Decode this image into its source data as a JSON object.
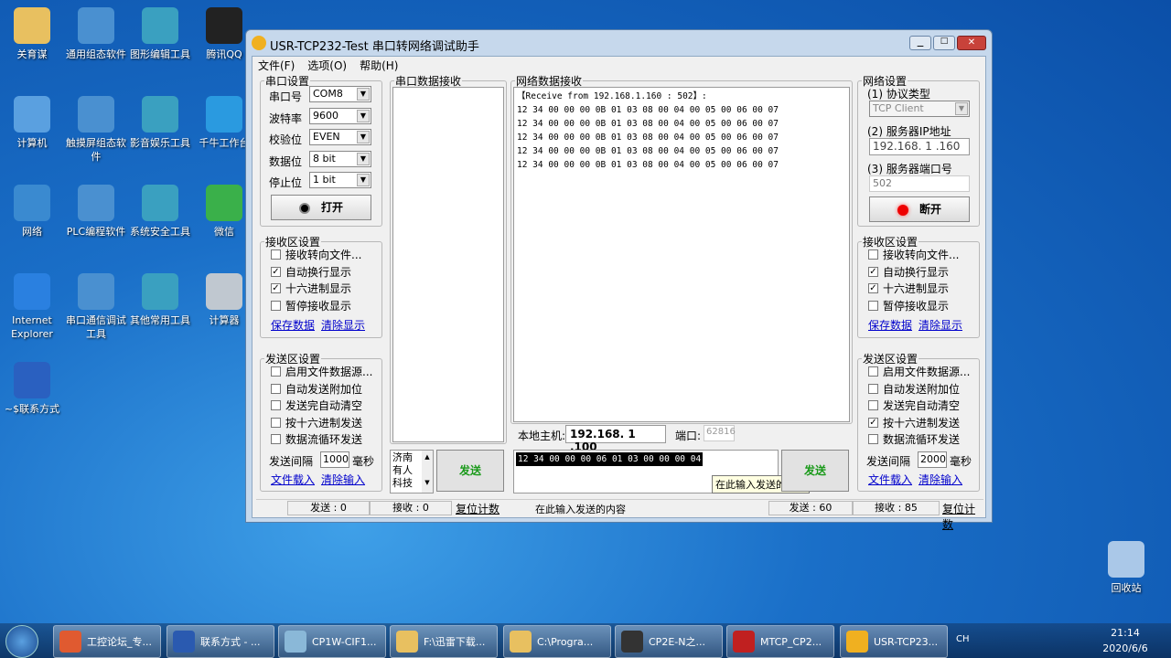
{
  "desktop": {
    "icons": [
      "关育谋",
      "通用组态软件",
      "图形编辑工具",
      "腾讯QQ",
      "计算机",
      "触摸屏组态软件",
      "影音娱乐工具",
      "千牛工作台",
      "网络",
      "PLC编程软件",
      "系统安全工具",
      "微信",
      "Internet Explorer",
      "串口通信调试工具",
      "其他常用工具",
      "计算器",
      "~$联系方式",
      "回收站"
    ]
  },
  "window": {
    "title": "USR-TCP232-Test 串口转网络调试助手",
    "menu": [
      "文件(F)",
      "选项(O)",
      "帮助(H)"
    ],
    "serial": {
      "legend": "串口设置",
      "fields": [
        {
          "label": "串口号",
          "value": "COM8"
        },
        {
          "label": "波特率",
          "value": "9600"
        },
        {
          "label": "校验位",
          "value": "EVEN"
        },
        {
          "label": "数据位",
          "value": "8 bit"
        },
        {
          "label": "停止位",
          "value": "1 bit"
        }
      ],
      "open_button": "打开"
    },
    "recv_left": {
      "legend": "接收区设置",
      "options": [
        {
          "label": "接收转向文件...",
          "checked": false
        },
        {
          "label": "自动换行显示",
          "checked": true
        },
        {
          "label": "十六进制显示",
          "checked": true
        },
        {
          "label": "暂停接收显示",
          "checked": false
        }
      ],
      "save": "保存数据",
      "clear": "清除显示"
    },
    "send_left": {
      "legend": "发送区设置",
      "options": [
        {
          "label": "启用文件数据源...",
          "checked": false
        },
        {
          "label": "自动发送附加位",
          "checked": false
        },
        {
          "label": "发送完自动清空",
          "checked": false
        },
        {
          "label": "按十六进制发送",
          "checked": false
        },
        {
          "label": "数据流循环发送",
          "checked": false
        }
      ],
      "interval_label": "发送间隔",
      "interval": "1000",
      "unit": "毫秒",
      "load": "文件载入",
      "clear": "清除输入"
    },
    "serial_recv": {
      "legend": "串口数据接收"
    },
    "serial_send": {
      "text": "济南\n有人\n科技",
      "button": "发送"
    },
    "net_recv": {
      "legend": "网络数据接收",
      "lines": [
        "【Receive from 192.168.1.160 : 502】:",
        "12 34 00 00 00 0B 01 03 08 00 04 00 05 00 06 00 07",
        "12 34 00 00 00 0B 01 03 08 00 04 00 05 00 06 00 07",
        "12 34 00 00 00 0B 01 03 08 00 04 00 05 00 06 00 07",
        "12 34 00 00 00 0B 01 03 08 00 04 00 05 00 06 00 07",
        "12 34 00 00 00 0B 01 03 08 00 04 00 05 00 06 00 07"
      ]
    },
    "local": {
      "host_label": "本地主机:",
      "host": "192.168. 1 .100",
      "port_label": "端口:",
      "port": "62816"
    },
    "net_send": {
      "text": "12 34 00 00 00 06 01 03 00 00 00 04",
      "button": "发送",
      "tooltip": "在此输入发送的内容"
    },
    "net": {
      "legend": "网络设置",
      "proto_label": "(1) 协议类型",
      "proto": "TCP Client",
      "ip_label": "(2) 服务器IP地址",
      "ip": "192.168. 1 .160",
      "port_label": "(3) 服务器端口号",
      "port": "502",
      "button": "断开"
    },
    "recv_right": {
      "legend": "接收区设置",
      "options": [
        {
          "label": "接收转向文件...",
          "checked": false
        },
        {
          "label": "自动换行显示",
          "checked": true
        },
        {
          "label": "十六进制显示",
          "checked": true
        },
        {
          "label": "暂停接收显示",
          "checked": false
        }
      ],
      "save": "保存数据",
      "clear": "清除显示"
    },
    "send_right": {
      "legend": "发送区设置",
      "options": [
        {
          "label": "启用文件数据源...",
          "checked": false
        },
        {
          "label": "自动发送附加位",
          "checked": false
        },
        {
          "label": "发送完自动清空",
          "checked": false
        },
        {
          "label": "按十六进制发送",
          "checked": true
        },
        {
          "label": "数据流循环发送",
          "checked": false
        }
      ],
      "interval_label": "发送间隔",
      "interval": "2000",
      "unit": "毫秒",
      "load": "文件载入",
      "clear": "清除输入"
    },
    "status": {
      "left_send": "发送 : 0",
      "left_recv": "接收 : 0",
      "reset": "复位计数",
      "hint": "在此输入发送的内容",
      "right_send": "发送 : 60",
      "right_recv": "接收 : 85",
      "reset2": "复位计数"
    }
  },
  "taskbar": {
    "items": [
      "工控论坛_专...",
      "联系方式 - ...",
      "CP1W-CIF1...",
      "F:\\迅雷下载...",
      "C:\\Progra...",
      "CP2E-N之...",
      "MTCP_CP2...",
      "USR-TCP23..."
    ],
    "lang": "CH",
    "time": "21:14",
    "date": "2020/6/6"
  }
}
